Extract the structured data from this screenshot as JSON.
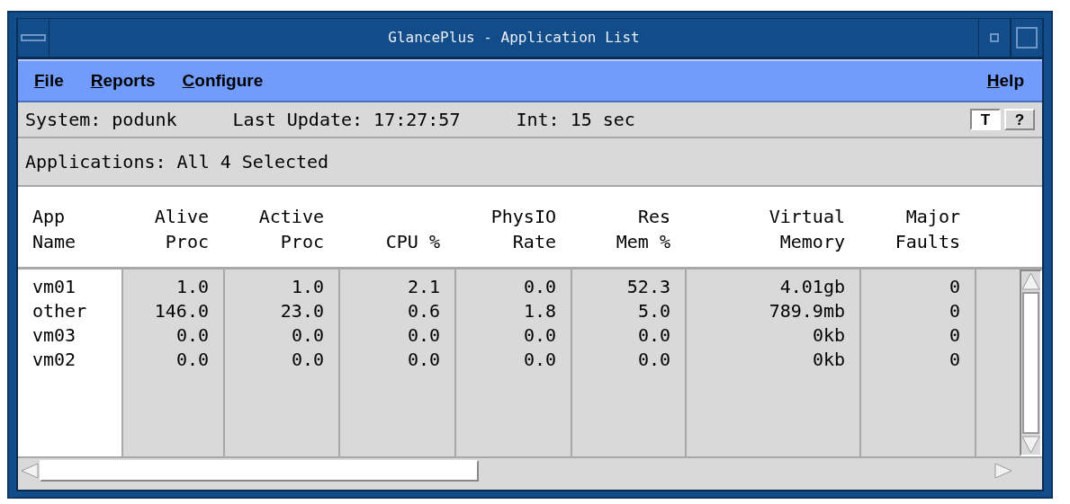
{
  "window": {
    "title": "GlancePlus - Application List"
  },
  "menu": [
    {
      "label": "File"
    },
    {
      "label": "Reports"
    },
    {
      "label": "Configure"
    },
    {
      "label": "Help"
    }
  ],
  "status": {
    "system": "System: podunk",
    "last_update": "Last Update: 17:27:57",
    "interval": "Int: 15 sec",
    "buttons": [
      "T",
      "?"
    ]
  },
  "selection": "Applications: All 4 Selected",
  "table": {
    "columns": [
      "App\nName",
      "Alive\nProc",
      "Active\nProc",
      "CPU %",
      "PhysIO\nRate",
      "Res\nMem %",
      "Virtual\nMemory",
      "Major\nFaults"
    ],
    "rows": [
      [
        "vm01",
        "1.0",
        "1.0",
        "2.1",
        "0.0",
        "52.3",
        "4.01gb",
        "0"
      ],
      [
        "other",
        "146.0",
        "23.0",
        "0.6",
        "1.8",
        "5.0",
        "789.9mb",
        "0"
      ],
      [
        "vm03",
        "0.0",
        "0.0",
        "0.0",
        "0.0",
        "0.0",
        "0kb",
        "0"
      ],
      [
        "vm02",
        "0.0",
        "0.0",
        "0.0",
        "0.0",
        "0.0",
        "0kb",
        "0"
      ]
    ]
  }
}
